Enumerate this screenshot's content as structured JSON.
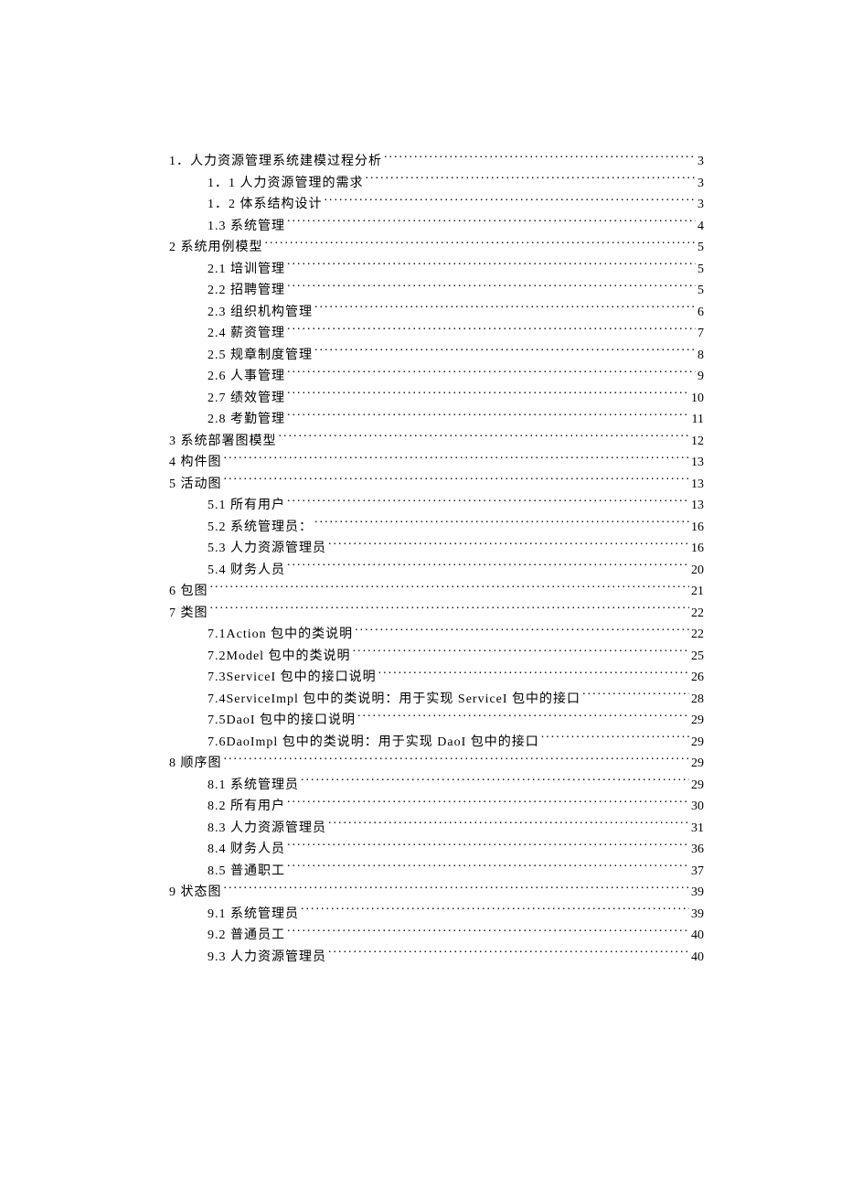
{
  "toc": [
    {
      "level": 1,
      "title": "1．人力资源管理系统建模过程分析",
      "page": "3"
    },
    {
      "level": 2,
      "title": "1．1 人力资源管理的需求",
      "page": "3"
    },
    {
      "level": 2,
      "title": "1．2 体系结构设计",
      "page": "3"
    },
    {
      "level": 2,
      "title": "1.3 系统管理",
      "page": "4"
    },
    {
      "level": 1,
      "title": "2  系统用例模型",
      "page": "5"
    },
    {
      "level": 2,
      "title": "2.1 培训管理",
      "page": "5"
    },
    {
      "level": 2,
      "title": "2.2 招聘管理",
      "page": "5"
    },
    {
      "level": 2,
      "title": "2.3 组织机构管理",
      "page": "6"
    },
    {
      "level": 2,
      "title": "2.4 薪资管理",
      "page": "7"
    },
    {
      "level": 2,
      "title": "2.5 规章制度管理",
      "page": "8"
    },
    {
      "level": 2,
      "title": "2.6 人事管理",
      "page": "9"
    },
    {
      "level": 2,
      "title": "2.7 绩效管理",
      "page": "10"
    },
    {
      "level": 2,
      "title": "2.8 考勤管理",
      "page": "11"
    },
    {
      "level": 1,
      "title": "3  系统部署图模型",
      "page": "12"
    },
    {
      "level": 1,
      "title": "4  构件图",
      "page": "13"
    },
    {
      "level": 1,
      "title": "5  活动图",
      "page": "13"
    },
    {
      "level": 2,
      "title": "5.1 所有用户",
      "page": "13"
    },
    {
      "level": 2,
      "title": "5.2 系统管理员：",
      "page": "16"
    },
    {
      "level": 2,
      "title": "5.3 人力资源管理员",
      "page": "16"
    },
    {
      "level": 2,
      "title": "5.4 财务人员",
      "page": "20"
    },
    {
      "level": 1,
      "title": "6  包图",
      "page": "21"
    },
    {
      "level": 1,
      "title": "7  类图",
      "page": "22"
    },
    {
      "level": 2,
      "title": "7.1Action 包中的类说明",
      "page": "22"
    },
    {
      "level": 2,
      "title": "7.2Model 包中的类说明",
      "page": "25"
    },
    {
      "level": 2,
      "title": "7.3ServiceI 包中的接口说明",
      "page": "26"
    },
    {
      "level": 2,
      "title": "7.4ServiceImpl 包中的类说明：用于实现 ServiceI 包中的接口",
      "page": "28"
    },
    {
      "level": 2,
      "title": "7.5DaoI 包中的接口说明",
      "page": "29"
    },
    {
      "level": 2,
      "title": "7.6DaoImpl 包中的类说明：用于实现 DaoI 包中的接口",
      "page": "29"
    },
    {
      "level": 1,
      "title": "8  顺序图",
      "page": "29"
    },
    {
      "level": 2,
      "title": "8.1 系统管理员",
      "page": "29"
    },
    {
      "level": 2,
      "title": "8.2 所有用户",
      "page": "30"
    },
    {
      "level": 2,
      "title": "8.3 人力资源管理员",
      "page": "31"
    },
    {
      "level": 2,
      "title": "8.4 财务人员",
      "page": "36"
    },
    {
      "level": 2,
      "title": "8.5 普通职工",
      "page": "37"
    },
    {
      "level": 1,
      "title": "9  状态图",
      "page": "39"
    },
    {
      "level": 2,
      "title": "9.1 系统管理员",
      "page": "39"
    },
    {
      "level": 2,
      "title": "9.2 普通员工",
      "page": "40"
    },
    {
      "level": 2,
      "title": "9.3 人力资源管理员",
      "page": "40"
    }
  ]
}
